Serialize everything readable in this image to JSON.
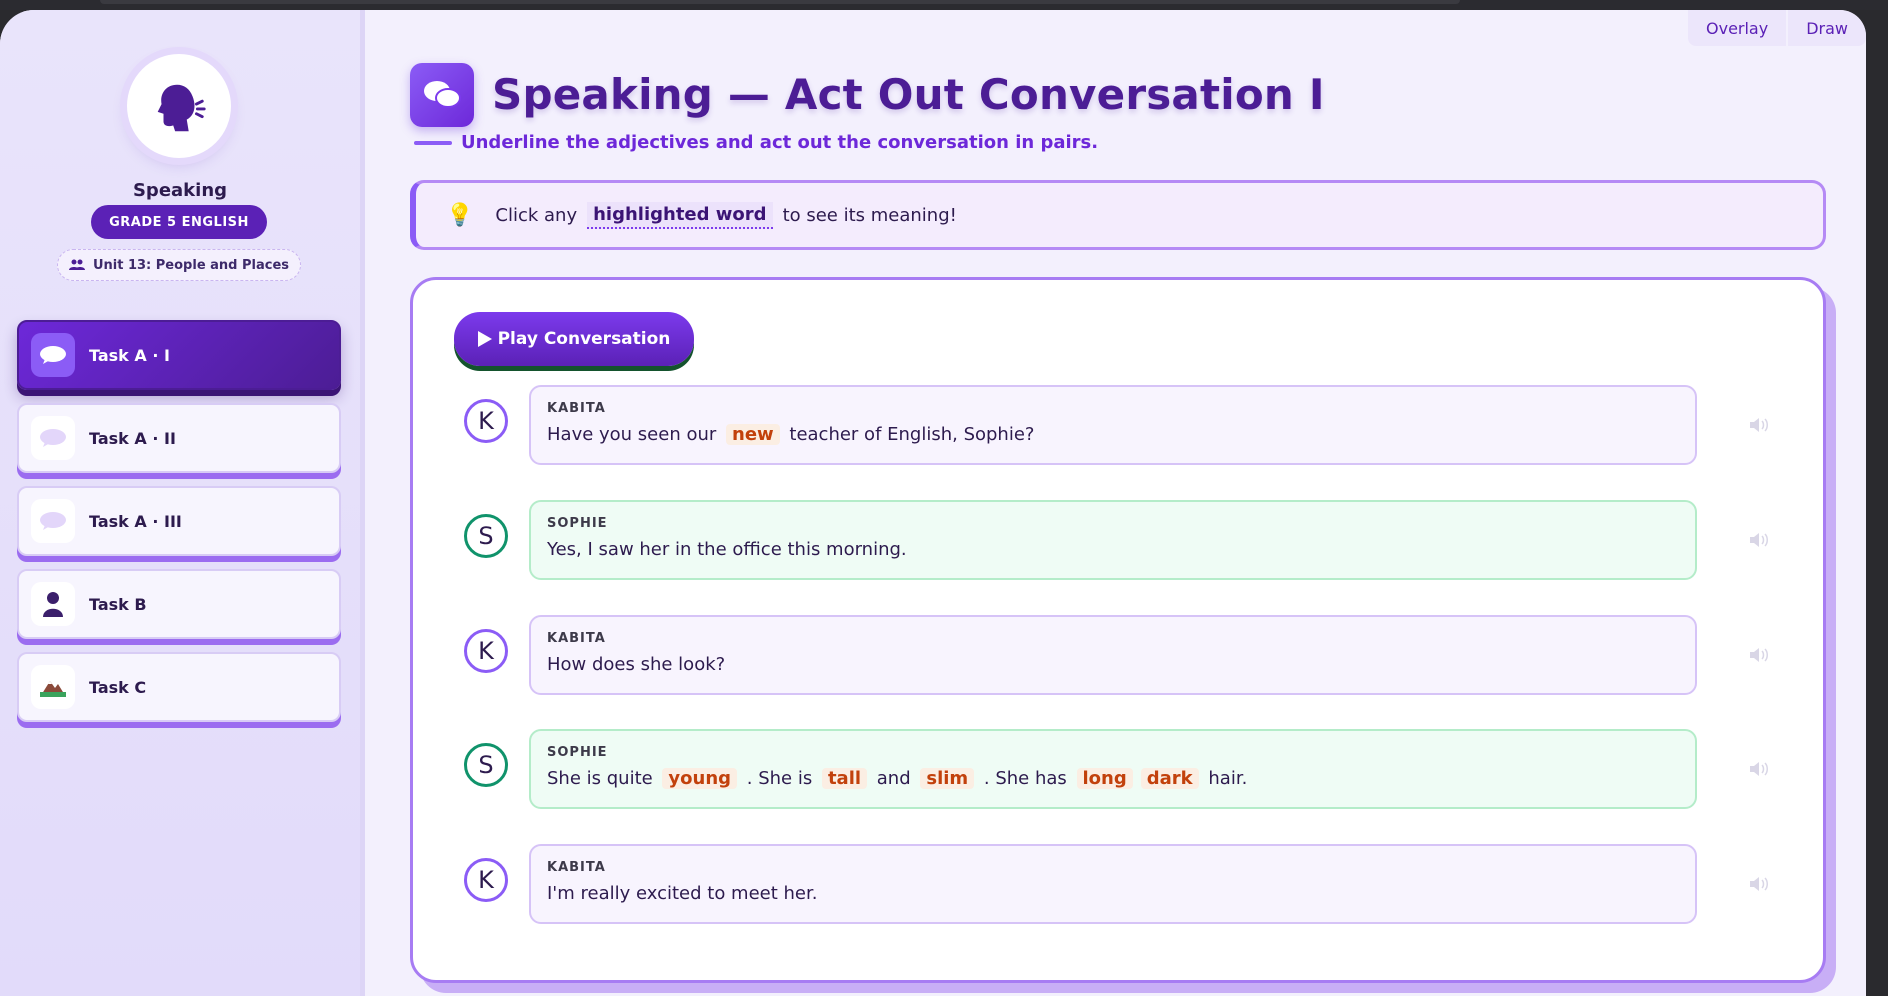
{
  "overlay": {
    "overlay_label": "Overlay",
    "draw_label": "Draw"
  },
  "sidebar": {
    "title": "Speaking",
    "grade": "GRADE 5 ENGLISH",
    "unit": "Unit 13: People and Places",
    "tasks": [
      {
        "label": "Task A · I",
        "icon": "speech-bubble-icon",
        "active": true
      },
      {
        "label": "Task A · II",
        "icon": "speech-bubble-icon",
        "active": false
      },
      {
        "label": "Task A · III",
        "icon": "speech-bubble-icon",
        "active": false
      },
      {
        "label": "Task B",
        "icon": "person-icon",
        "active": false
      },
      {
        "label": "Task C",
        "icon": "mountain-icon",
        "active": false
      }
    ]
  },
  "main": {
    "title": "Speaking — Act Out Conversation I",
    "subtitle": "Underline the adjectives and act out the conversation in pairs.",
    "hint": {
      "before": "Click any",
      "word": "highlighted word",
      "after": "to see its meaning!"
    },
    "play_label": "Play Conversation",
    "conversation": [
      {
        "initial": "K",
        "speaker": "KABITA",
        "parts": [
          {
            "t": "Have you seen our"
          },
          {
            "adj": "new"
          },
          {
            "t": "teacher of English, Sophie?"
          }
        ]
      },
      {
        "initial": "S",
        "speaker": "SOPHIE",
        "parts": [
          {
            "t": "Yes, I saw her in the office this morning."
          }
        ]
      },
      {
        "initial": "K",
        "speaker": "KABITA",
        "parts": [
          {
            "t": "How does she look?"
          }
        ]
      },
      {
        "initial": "S",
        "speaker": "SOPHIE",
        "parts": [
          {
            "t": "She is quite"
          },
          {
            "adj": "young"
          },
          {
            "t": ". She is"
          },
          {
            "adj": "tall"
          },
          {
            "t": "and"
          },
          {
            "adj": "slim"
          },
          {
            "t": ". She has"
          },
          {
            "adj": "long"
          },
          {
            "adj": "dark"
          },
          {
            "t": "hair."
          }
        ]
      },
      {
        "initial": "K",
        "speaker": "KABITA",
        "parts": [
          {
            "t": "I'm really excited to meet her."
          }
        ]
      }
    ]
  },
  "colors": {
    "accent": "#6d28d9",
    "kabita": "#8b5cf6",
    "sophie": "#10936b",
    "adjective": "#c2410c"
  }
}
